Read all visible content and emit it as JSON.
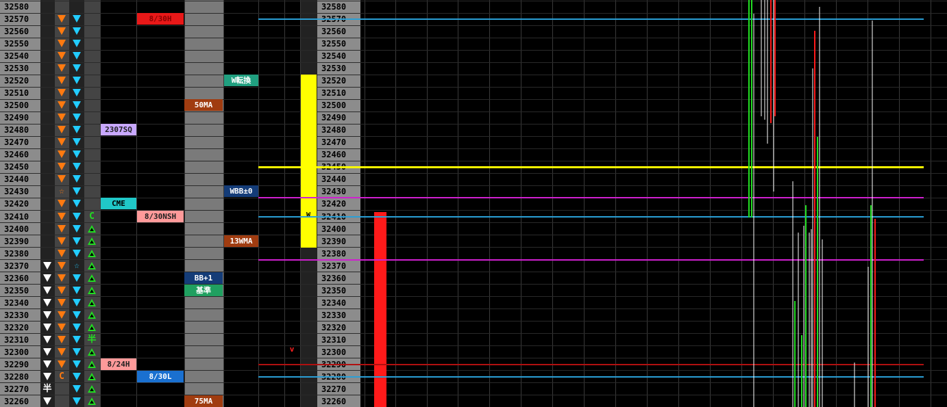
{
  "prices": [
    32580,
    32570,
    32560,
    32550,
    32540,
    32530,
    32520,
    32510,
    32500,
    32490,
    32480,
    32470,
    32460,
    32450,
    32440,
    32430,
    32420,
    32410,
    32400,
    32390,
    32380,
    32370,
    32360,
    32350,
    32340,
    32330,
    32320,
    32310,
    32300,
    32290,
    32280,
    32270,
    32260
  ],
  "colors": {
    "price_bg": "#8c8c8c",
    "orange": "#ff7a10",
    "cyan": "#22ccff",
    "green": "#22dd22",
    "yellow": "#ffff00",
    "red": "#ff1a1a",
    "magenta": "#d020d0",
    "blue_line": "#2a9fd6",
    "dark_red": "#b01010"
  },
  "col_white_down_rows": [
    32370,
    32360,
    32350,
    32340,
    32330,
    32320,
    32310,
    32300,
    32290,
    32280,
    32260
  ],
  "col_white_text": {
    "32270": "半"
  },
  "col_orange_down_rows": [
    32570,
    32560,
    32550,
    32540,
    32530,
    32520,
    32510,
    32500,
    32490,
    32480,
    32470,
    32460,
    32450,
    32440,
    32420,
    32410,
    32400,
    32390,
    32380,
    32370,
    32360,
    32350,
    32340,
    32330,
    32320,
    32310,
    32300,
    32290
  ],
  "col_orange_text": {
    "32430": "☆",
    "32280": "C"
  },
  "col_cyan_down_rows": [
    32570,
    32560,
    32550,
    32540,
    32530,
    32520,
    32510,
    32500,
    32490,
    32480,
    32470,
    32460,
    32450,
    32440,
    32430,
    32420,
    32410,
    32400,
    32390,
    32380,
    32360,
    32350,
    32340,
    32330,
    32320,
    32310,
    32300,
    32290,
    32280,
    32270,
    32260
  ],
  "col_cyan_text": {
    "32370": "☆"
  },
  "col_green_up_rows": [
    32400,
    32390,
    32380,
    32370,
    32360,
    32350,
    32340,
    32330,
    32320,
    32300,
    32290,
    32280,
    32270,
    32260
  ],
  "col_green_text": {
    "32410": "C",
    "32310": "半"
  },
  "labels": [
    {
      "row": 32570,
      "col": "c2",
      "text": "8/30H",
      "bg": "#e81818",
      "fg": "#8a0000"
    },
    {
      "row": 32480,
      "col": "c1",
      "text": "2307SQ",
      "bg": "#c8a8ff",
      "fg": "#202020"
    },
    {
      "row": 32420,
      "col": "c1",
      "text": "CME",
      "bg": "#20c8c8",
      "fg": "#000000"
    },
    {
      "row": 32410,
      "col": "c2",
      "text": "8/30NSH",
      "bg": "#ff9a9a",
      "fg": "#202020"
    },
    {
      "row": 32290,
      "col": "c1",
      "text": "8/24H",
      "bg": "#ff9a9a",
      "fg": "#202020"
    },
    {
      "row": 32280,
      "col": "c2",
      "text": "8/30L",
      "bg": "#1a70d0",
      "fg": "#ffffff"
    },
    {
      "row": 32500,
      "col": "c3",
      "text": "50MA",
      "bg": "#a03c10",
      "fg": "#ffffff"
    },
    {
      "row": 32360,
      "col": "c3",
      "text": "BB+1",
      "bg": "#143c78",
      "fg": "#ffffff"
    },
    {
      "row": 32350,
      "col": "c3",
      "text": "基準",
      "bg": "#20a060",
      "fg": "#ffffff"
    },
    {
      "row": 32260,
      "col": "c3",
      "text": "75MA",
      "bg": "#a03c10",
      "fg": "#ffffff"
    },
    {
      "row": 32520,
      "col": "c4",
      "text": "W転換",
      "bg": "#20a080",
      "fg": "#ffffff"
    },
    {
      "row": 32430,
      "col": "c4",
      "text": "WBB±0",
      "bg": "#143c78",
      "fg": "#ffffff"
    },
    {
      "row": 32390,
      "col": "c4",
      "text": "13WMA",
      "bg": "#a03c10",
      "fg": "#ffffff"
    }
  ],
  "marker_w": "W",
  "marker_v": "v",
  "yellow_bar": {
    "from": 32390,
    "to": 32520
  },
  "red_bar": {
    "from": 32260,
    "to": 32410
  },
  "hlines": [
    {
      "price": 32570,
      "color": "blue_line"
    },
    {
      "price": 32450,
      "color": "yellow"
    },
    {
      "price": 32425,
      "color": "magenta"
    },
    {
      "price": 32410,
      "color": "blue_line"
    },
    {
      "price": 32375,
      "color": "magenta"
    },
    {
      "price": 32290,
      "color": "dark_red"
    },
    {
      "price": 32280,
      "color": "blue_line"
    }
  ]
}
